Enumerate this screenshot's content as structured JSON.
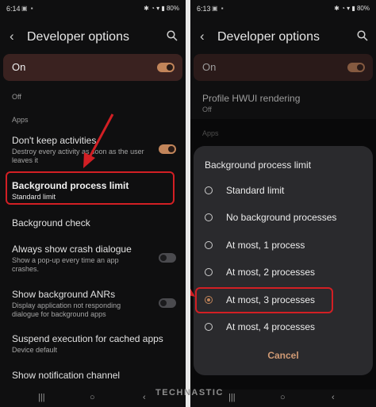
{
  "left": {
    "status": {
      "time": "6:14",
      "battery": "80%"
    },
    "header": {
      "title": "Developer options"
    },
    "on_row": {
      "label": "On"
    },
    "items": {
      "off_label": "Off",
      "apps_section": "Apps",
      "dont_keep_title": "Don't keep activities",
      "dont_keep_sub": "Destroy every activity as soon as the user leaves it",
      "bg_limit_title": "Background process limit",
      "bg_limit_sub": "Standard limit",
      "bg_check_title": "Background check",
      "crash_title": "Always show crash dialogue",
      "crash_sub": "Show a pop-up every time an app crashes.",
      "anr_title": "Show background ANRs",
      "anr_sub": "Display application not responding dialogue for background apps",
      "suspend_title": "Suspend execution for cached apps",
      "suspend_sub": "Device default",
      "notif_title": "Show notification channel"
    }
  },
  "right": {
    "status": {
      "time": "6:13",
      "battery": "80%"
    },
    "header": {
      "title": "Developer options"
    },
    "on_row": {
      "label": "On"
    },
    "items": {
      "hwui_title": "Profile HWUI rendering",
      "hwui_sub": "Off",
      "apps_section": "Apps"
    },
    "dialog": {
      "title": "Background process limit",
      "options": [
        "Standard limit",
        "No background processes",
        "At most, 1 process",
        "At most, 2 processes",
        "At most, 3 processes",
        "At most, 4 processes"
      ],
      "selected": 4,
      "cancel": "Cancel"
    }
  },
  "watermark": "TECHNASTIC",
  "colors": {
    "accent": "#c2855a",
    "highlight": "#d21f24",
    "background": "#0f0f10",
    "dialog": "#2a2a2d"
  }
}
